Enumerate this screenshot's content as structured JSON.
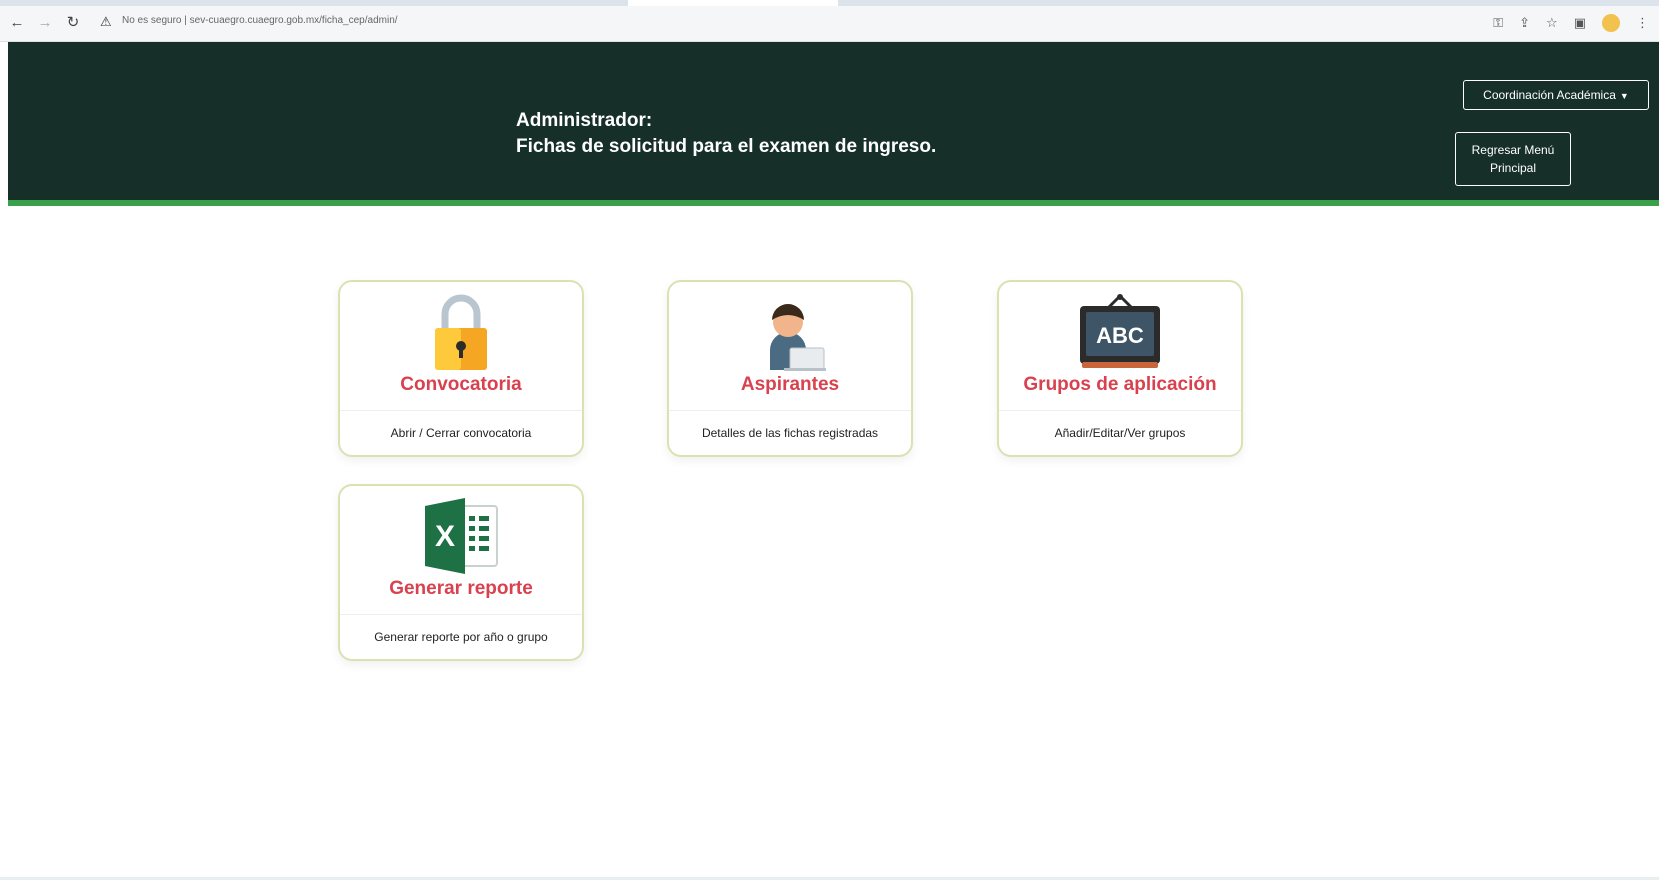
{
  "browser": {
    "url": "No es seguro | sev-cuaegro.cuaegro.gob.mx/ficha_cep/admin/",
    "warning_icon": "warning-icon"
  },
  "header": {
    "title_line1": "Administrador:",
    "title_line2": "Fichas de solicitud para el examen de ingreso.",
    "dropdown_label": "Coordinación Académica",
    "return_button": "Regresar Menú Principal",
    "background_color": "#163029",
    "accent_color": "#3aa14a"
  },
  "cards": [
    {
      "title": "Convocatoria",
      "description": "Abrir / Cerrar convocatoria",
      "icon": "lock-icon"
    },
    {
      "title": "Aspirantes",
      "description": "Detalles de las fichas registradas",
      "icon": "applicant-icon"
    },
    {
      "title": "Grupos de aplicación",
      "description": "Añadir/Editar/Ver grupos",
      "icon": "abc-board-icon"
    },
    {
      "title": "Generar reporte",
      "description": "Generar reporte por año o grupo",
      "icon": "excel-icon"
    }
  ],
  "colors": {
    "card_title": "#d9414f",
    "card_border": "#d8e3b2"
  }
}
